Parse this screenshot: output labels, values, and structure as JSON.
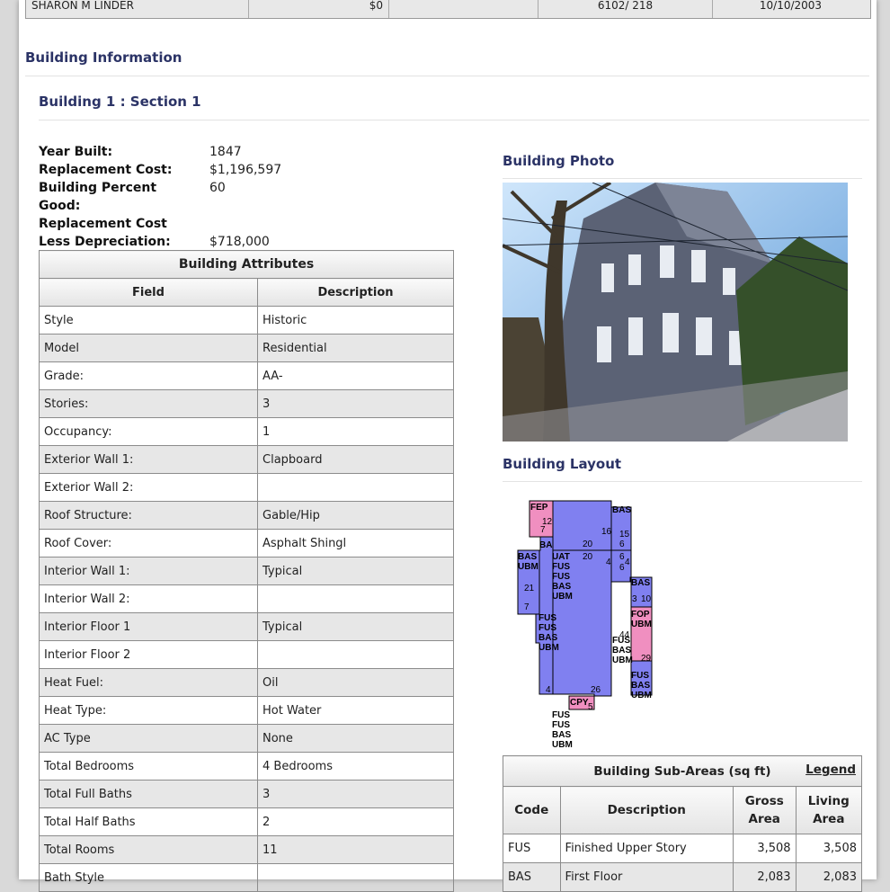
{
  "owner_row": {
    "name": "SHARON M LINDER",
    "price": "$0",
    "blank": "",
    "book_page": "6102/ 218",
    "date": "10/10/2003"
  },
  "building_info_title": "Building Information",
  "building_section_title": "Building 1 : Section 1",
  "summary": [
    {
      "label": "Year Built:",
      "value": "1847"
    },
    {
      "label": "Replacement Cost:",
      "value": "$1,196,597"
    },
    {
      "label": "Building Percent Good:",
      "value": "60"
    },
    {
      "label": "Replacement Cost Less Depreciation:",
      "value": "$718,000"
    }
  ],
  "attributes": {
    "caption": "Building Attributes",
    "headers": [
      "Field",
      "Description"
    ],
    "rows": [
      {
        "field": "Style",
        "desc": "Historic"
      },
      {
        "field": "Model",
        "desc": "Residential"
      },
      {
        "field": "Grade:",
        "desc": "AA-"
      },
      {
        "field": "Stories:",
        "desc": "3"
      },
      {
        "field": "Occupancy:",
        "desc": "1"
      },
      {
        "field": "Exterior Wall 1:",
        "desc": "Clapboard"
      },
      {
        "field": "Exterior Wall 2:",
        "desc": ""
      },
      {
        "field": "Roof Structure:",
        "desc": "Gable/Hip"
      },
      {
        "field": "Roof Cover:",
        "desc": "Asphalt Shingl"
      },
      {
        "field": "Interior Wall 1:",
        "desc": "Typical"
      },
      {
        "field": "Interior Wall 2:",
        "desc": ""
      },
      {
        "field": "Interior Floor 1",
        "desc": "Typical"
      },
      {
        "field": "Interior Floor 2",
        "desc": ""
      },
      {
        "field": "Heat Fuel:",
        "desc": "Oil"
      },
      {
        "field": "Heat Type:",
        "desc": "Hot Water"
      },
      {
        "field": "AC Type",
        "desc": "None"
      },
      {
        "field": "Total Bedrooms",
        "desc": "4 Bedrooms"
      },
      {
        "field": "Total Full Baths",
        "desc": "3"
      },
      {
        "field": "Total Half Baths",
        "desc": "2"
      },
      {
        "field": "Total Rooms",
        "desc": "11"
      },
      {
        "field": "Bath Style",
        "desc": ""
      }
    ]
  },
  "photo_title": "Building Photo",
  "layout_title": "Building Layout",
  "layout_labels": {
    "fep": "FEP",
    "bas_top": "BAS",
    "n12": "12",
    "n7a": "7",
    "n16": "16",
    "n15": "15",
    "ba": "BA",
    "n20a": "20",
    "n6a": "6",
    "bas_left": "BAS",
    "ubm_left": "UBM",
    "uat": "UAT",
    "n20b": "20",
    "n6b": "6",
    "n4a": "4",
    "n4b": "4",
    "n6c": "6",
    "stack1": "FUS",
    "stack2": "FUS",
    "stack3": "BAS",
    "stack4": "UBM",
    "n21": "21",
    "n7b": "7",
    "bas_r": "BAS",
    "n3": "3",
    "n10": "10",
    "fop": "FOP",
    "ubm_r": "UBM",
    "fus_l": "FUS",
    "fus_l2": "FUS",
    "bas_l": "BAS",
    "ubm_l": "UBM",
    "n44": "44",
    "fus_m": "FUS",
    "bas_m": "BAS",
    "ubm_m": "UBM",
    "n29": "29",
    "fus_r2": "FUS",
    "bas_r2": "BAS",
    "ubm_r2": "UBM",
    "n4c": "4",
    "n26": "26",
    "cpy": "CPY",
    "n5": "5",
    "bot1": "FUS",
    "bot2": "FUS",
    "bot3": "BAS",
    "bot4": "UBM"
  },
  "subareas": {
    "caption": "Building Sub-Areas (sq ft)",
    "legend": "Legend",
    "headers": [
      "Code",
      "Description",
      "Gross Area",
      "Living Area"
    ],
    "rows": [
      {
        "code": "FUS",
        "desc": "Finished Upper Story",
        "gross": "3,508",
        "living": "3,508"
      },
      {
        "code": "BAS",
        "desc": "First Floor",
        "gross": "2,083",
        "living": "2,083"
      }
    ]
  }
}
